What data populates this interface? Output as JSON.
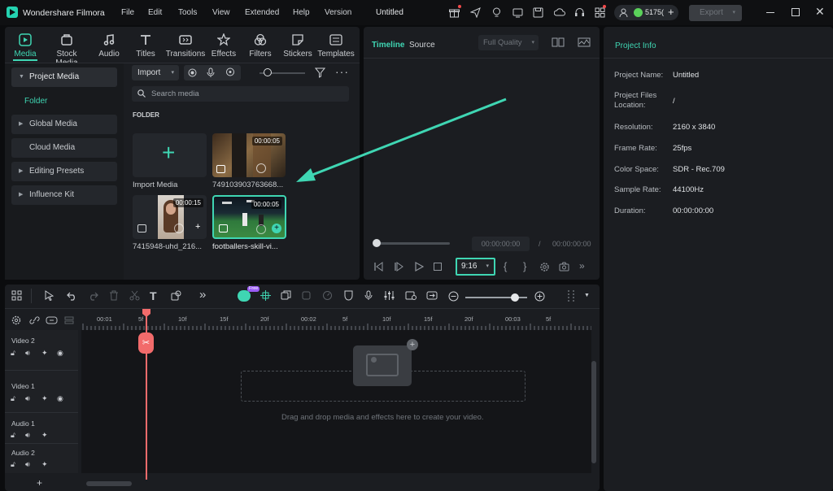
{
  "app": {
    "name": "Wondershare Filmora",
    "project_title": "Untitled",
    "credits": "5175(",
    "export_label": "Export"
  },
  "menu": [
    "File",
    "Edit",
    "Tools",
    "View",
    "Extended",
    "Help",
    "Version"
  ],
  "toolbar_tabs": [
    {
      "label": "Media",
      "icon": "media-icon",
      "active": true
    },
    {
      "label": "Stock Media",
      "icon": "stock-media-icon"
    },
    {
      "label": "Audio",
      "icon": "audio-icon"
    },
    {
      "label": "Titles",
      "icon": "titles-icon"
    },
    {
      "label": "Transitions",
      "icon": "transitions-icon"
    },
    {
      "label": "Effects",
      "icon": "effects-icon"
    },
    {
      "label": "Filters",
      "icon": "filters-icon"
    },
    {
      "label": "Stickers",
      "icon": "stickers-icon"
    },
    {
      "label": "Templates",
      "icon": "templates-icon"
    }
  ],
  "sidebar": {
    "items": [
      {
        "label": "Project Media"
      },
      {
        "label": "Folder"
      },
      {
        "label": "Global Media"
      },
      {
        "label": "Cloud Media"
      },
      {
        "label": "Editing Presets"
      },
      {
        "label": "Influence Kit"
      }
    ]
  },
  "media": {
    "import_label": "Import",
    "search_placeholder": "Search media",
    "folder_heading": "FOLDER",
    "import_media_label": "Import Media",
    "items": [
      {
        "name": "749103903763668...",
        "duration": "00:00:05"
      },
      {
        "name": "7415948-uhd_216...",
        "duration": "00:00:15"
      },
      {
        "name": "footballers-skill-vi...",
        "duration": "00:00:05"
      }
    ]
  },
  "preview": {
    "tabs": [
      "Timeline",
      "Source"
    ],
    "quality": "Full Quality",
    "current_time": "00:00:00:00",
    "separator": "/",
    "total_time": "00:00:00:00",
    "aspect_ratio": "9:16"
  },
  "project_info": {
    "title": "Project Info",
    "rows": [
      {
        "label": "Project Name:",
        "value": "Untitled"
      },
      {
        "label": "Project Files Location:",
        "value": "/"
      },
      {
        "label": "Resolution:",
        "value": "2160 x 3840"
      },
      {
        "label": "Frame Rate:",
        "value": "25fps"
      },
      {
        "label": "Color Space:",
        "value": "SDR - Rec.709"
      },
      {
        "label": "Sample Rate:",
        "value": "44100Hz"
      },
      {
        "label": "Duration:",
        "value": "00:00:00:00"
      }
    ]
  },
  "timeline": {
    "ruler_labels": [
      "00:01",
      "5f",
      "10f",
      "15f",
      "20f",
      "00:02",
      "5f",
      "10f",
      "15f",
      "20f",
      "00:03",
      "5f"
    ],
    "tracks": [
      "Video 2",
      "Video 1",
      "Audio 1",
      "Audio 2"
    ],
    "drop_hint": "Drag and drop media and effects here to create your video.",
    "ai_badge": "Free"
  },
  "colors": {
    "accent": "#3fd6b3",
    "playhead": "#f26b6b",
    "panel": "#1b1d21"
  }
}
